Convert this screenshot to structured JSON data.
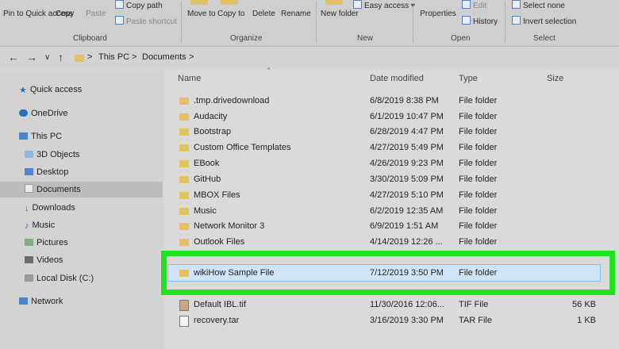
{
  "ribbon": {
    "pin_label": "Pin to Quick access",
    "copy_label": "Copy",
    "paste_label": "Paste",
    "copy_path_label": "Copy path",
    "paste_shortcut_label": "Paste shortcut",
    "clipboard_group": "Clipboard",
    "move_to_label": "Move to",
    "copy_to_label": "Copy to",
    "delete_label": "Delete",
    "rename_label": "Rename",
    "organize_group": "Organize",
    "new_folder_label": "New folder",
    "easy_access_label": "Easy access",
    "new_group": "New",
    "properties_label": "Properties",
    "edit_label": "Edit",
    "history_label": "History",
    "open_group": "Open",
    "select_none_label": "Select none",
    "invert_selection_label": "Invert selection",
    "select_group": "Select"
  },
  "nav": {
    "back": "←",
    "forward": "→",
    "dropdown": "∨",
    "up": "↑",
    "crumb_this_pc": "This PC",
    "crumb_sep": ">",
    "crumb_documents": "Documents"
  },
  "sidebar": {
    "items": [
      {
        "label": "Quick access"
      },
      {
        "label": "OneDrive"
      },
      {
        "label": "This PC"
      },
      {
        "label": "3D Objects"
      },
      {
        "label": "Desktop"
      },
      {
        "label": "Documents"
      },
      {
        "label": "Downloads"
      },
      {
        "label": "Music"
      },
      {
        "label": "Pictures"
      },
      {
        "label": "Videos"
      },
      {
        "label": "Local Disk (C:)"
      },
      {
        "label": "Network"
      }
    ]
  },
  "columns": {
    "name": "Name",
    "date": "Date modified",
    "type": "Type",
    "size": "Size"
  },
  "files": [
    {
      "name": ".tmp.drivedownload",
      "date": "6/8/2019 8:38 PM",
      "type": "File folder",
      "size": ""
    },
    {
      "name": "Audacity",
      "date": "6/1/2019 10:47 PM",
      "type": "File folder",
      "size": ""
    },
    {
      "name": "Bootstrap",
      "date": "6/28/2019 4:47 PM",
      "type": "File folder",
      "size": ""
    },
    {
      "name": "Custom Office Templates",
      "date": "4/27/2019 5:49 PM",
      "type": "File folder",
      "size": ""
    },
    {
      "name": "EBook",
      "date": "4/26/2019 9:23 PM",
      "type": "File folder",
      "size": ""
    },
    {
      "name": "GitHub",
      "date": "3/30/2019 5:09 PM",
      "type": "File folder",
      "size": ""
    },
    {
      "name": "MBOX Files",
      "date": "4/27/2019 5:10 PM",
      "type": "File folder",
      "size": ""
    },
    {
      "name": "Music",
      "date": "6/2/2019 12:35 AM",
      "type": "File folder",
      "size": ""
    },
    {
      "name": "Network Monitor 3",
      "date": "6/9/2019 1:51 AM",
      "type": "File folder",
      "size": ""
    },
    {
      "name": "Outlook Files",
      "date": "4/14/2019 12:26 ...",
      "type": "File folder",
      "size": ""
    },
    {
      "name": "wikiHow Sample File",
      "date": "7/12/2019 3:50 PM",
      "type": "File folder",
      "size": ""
    },
    {
      "name": "Default IBL.tif",
      "date": "11/30/2016 12:06...",
      "type": "TIF File",
      "size": "56 KB"
    },
    {
      "name": "recovery.tar",
      "date": "3/16/2019 3:30 PM",
      "type": "TAR File",
      "size": "1 KB"
    }
  ]
}
